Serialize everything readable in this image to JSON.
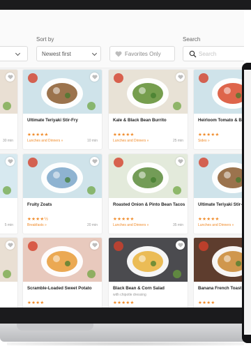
{
  "filters": {
    "sort_label": "Sort by",
    "sort_value": "Newest first",
    "favorites_label": "Favorites Only",
    "search_label": "Search",
    "search_placeholder": "Search"
  },
  "cards": [
    {
      "title": "",
      "subtitle": "",
      "rating": 0,
      "stars": "",
      "category": "",
      "time": "30 min",
      "colors": [
        "#e9dfd3",
        "#b94b2f"
      ]
    },
    {
      "title": "Ultimate Teriyaki Stir-Fry",
      "subtitle": "",
      "rating": 5,
      "stars": "★★★★★",
      "category": "Lunches and Dinners »",
      "time": "10 min",
      "colors": [
        "#cfe3ea",
        "#8a5a2e"
      ]
    },
    {
      "title": "Kale & Black Bean Burrito",
      "subtitle": "",
      "rating": 5,
      "stars": "★★★★★",
      "category": "Lunches and Dinners »",
      "time": "25 min",
      "colors": [
        "#e8e2d6",
        "#5e8d2f"
      ]
    },
    {
      "title": "Heirloom Tomato & Basil T",
      "subtitle": "",
      "rating": 5,
      "stars": "★★★★★",
      "category": "Sides »",
      "time": "",
      "colors": [
        "#cfe3ea",
        "#d84a2c"
      ]
    },
    {
      "title": "",
      "subtitle": "",
      "rating": 0,
      "stars": "",
      "category": "",
      "time": "5 min",
      "colors": [
        "#d7e9f0",
        "#6aa1c4"
      ]
    },
    {
      "title": "Fruity Zoats",
      "subtitle": "",
      "rating": 4.5,
      "stars": "★★★★½",
      "category": "Breakfasts »",
      "time": "20 min",
      "colors": [
        "#cfe3ea",
        "#7aa6c9"
      ]
    },
    {
      "title": "Roasted Onion & Pinto Bean Tacos",
      "subtitle": "",
      "rating": 5,
      "stars": "★★★★★",
      "category": "Lunches and Dinners »",
      "time": "35 min",
      "colors": [
        "#e3eadb",
        "#5a8b3a"
      ]
    },
    {
      "title": "Ultimate Teriyaki Stir-Fry",
      "subtitle": "",
      "rating": 5,
      "stars": "★★★★★",
      "category": "Lunches and Dinners »",
      "time": "",
      "colors": [
        "#cfe3ea",
        "#8a5a2e"
      ]
    },
    {
      "title": "",
      "subtitle": "",
      "rating": 0,
      "stars": "",
      "category": "",
      "time": "",
      "colors": [
        "#e9dfd3",
        "#c36b35"
      ]
    },
    {
      "title": "Scramble-Loaded Sweet Potato",
      "subtitle": "",
      "rating": 4,
      "stars": "★★★★",
      "category": "",
      "time": "",
      "colors": [
        "#e8c9bd",
        "#e89a35"
      ]
    },
    {
      "title": "Black Bean & Corn Salad",
      "subtitle": "with chipotle dressing",
      "rating": 5,
      "stars": "★★★★★",
      "category": "",
      "time": "",
      "colors": [
        "#4b4b4f",
        "#e9b13a"
      ]
    },
    {
      "title": "Banana French Toast",
      "subtitle": "",
      "rating": 4,
      "stars": "★★★★",
      "category": "",
      "time": "",
      "colors": [
        "#5e3d2e",
        "#c9862f"
      ]
    }
  ]
}
